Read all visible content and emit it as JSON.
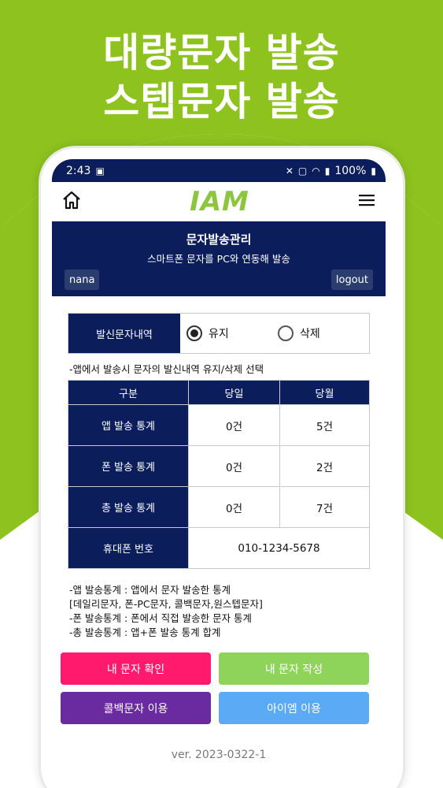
{
  "promo": {
    "headline_line1": "대량문자 발송",
    "headline_line2": "스텝문자 발송",
    "accent_color": "#8dc21f"
  },
  "status_bar": {
    "time": "2:43",
    "battery": "100%"
  },
  "app_bar": {
    "logo": "IAM",
    "home_icon": "home-icon",
    "menu_icon": "hamburger-menu-icon"
  },
  "header": {
    "title": "문자발송관리",
    "subtitle": "스마트폰 문자를 PC와 연동해 발송",
    "user_label": "nana",
    "logout_label": "logout"
  },
  "retention": {
    "label": "발신문자내역",
    "options": [
      {
        "label": "유지",
        "selected": true
      },
      {
        "label": "삭제",
        "selected": false
      }
    ],
    "note": "-앱에서 발송시 문자의 발신내역 유지/삭제 선택"
  },
  "stats_table": {
    "headers": [
      "구분",
      "당일",
      "당월"
    ],
    "rows": [
      {
        "label": "앱 발송 통계",
        "today": "0건",
        "month": "5건"
      },
      {
        "label": "폰 발송 통계",
        "today": "0건",
        "month": "2건"
      },
      {
        "label": "총 발송 통계",
        "today": "0건",
        "month": "7건"
      }
    ],
    "phone_label": "휴대폰 번호",
    "phone_value": "010-1234-5678"
  },
  "notes": [
    "-앱 발송통계 : 앱에서 문자 발송한 통계",
    "[데일리문자, 폰-PC문자, 콜백문자,원스텝문자]",
    "-폰 발송통계 : 폰에서 직접 발송한 문자 통계",
    "-총 발송통계 : 앱+폰 발송 통계 합계"
  ],
  "buttons": {
    "my_messages": "내 문자 확인",
    "write_message": "내 문자 작성",
    "callback": "콜백문자 이용",
    "iam": "아이엠 이용"
  },
  "colors": {
    "navy": "#0b1e5b",
    "btn_pink": "#ff1a6e",
    "btn_green": "#8fd45a",
    "btn_purple": "#6a2aa0",
    "btn_blue": "#5aaaf5"
  },
  "version": "ver. 2023-0322-1"
}
